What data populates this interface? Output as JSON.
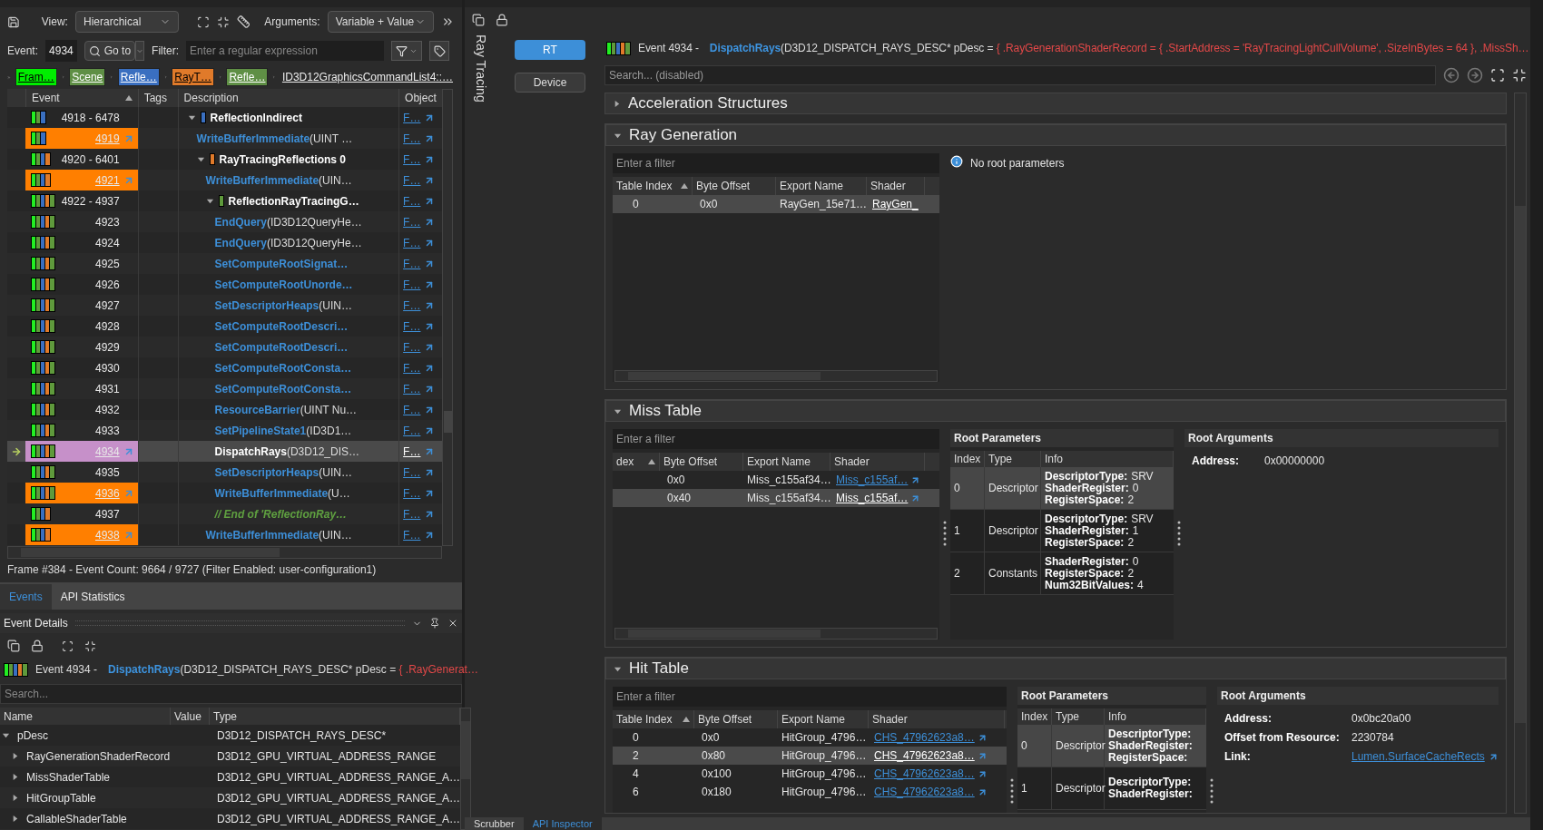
{
  "events": {
    "toolbar": {
      "view_label": "View:",
      "view_value": "Hierarchical",
      "arguments_label": "Arguments:",
      "arguments_value": "Variable + Value"
    },
    "search": {
      "event_label": "Event:",
      "event_value": "4934",
      "goto_label": "Go to",
      "filter_label": "Filter:",
      "filter_placeholder": "Enter a regular expression"
    },
    "breadcrumbs": [
      {
        "label": "Fram…",
        "color": "#00ee00"
      },
      {
        "label": "Scene",
        "color": "#5f8f45"
      },
      {
        "label": "Refle…",
        "color": "#3a6fc0"
      },
      {
        "label": "RayT…",
        "color": "#e07a2a"
      },
      {
        "label": "Refle…",
        "color": "#5f8f45"
      },
      {
        "label": "ID3D12GraphicsCommandList4::…"
      }
    ],
    "columns": [
      "Event",
      "Tags",
      "Description",
      "Object"
    ],
    "rows": [
      {
        "event": "4918 - 6478",
        "markers": [
          {
            "color": "#22ee22"
          },
          {
            "color": "#5f9a3c"
          },
          {
            "color": "#3a6fc0"
          }
        ],
        "marked": false,
        "selected": false,
        "kind": "group",
        "name": "ReflectionIndirect",
        "color": "#3a6fc0",
        "expanded": true,
        "object": "F…",
        "children": [
          {
            "event": "4919",
            "markers": [
              {
                "color": "#22ee22"
              },
              {
                "color": "#5f9a3c"
              },
              {
                "color": "#3a6fc0"
              }
            ],
            "marked": true,
            "selected": false,
            "kind": "call",
            "name": "WriteBufferImmediate",
            "args": "(UINT …",
            "object": "F…"
          },
          {
            "event": "4920 - 6401",
            "markers": [
              {
                "color": "#22ee22"
              },
              {
                "color": "#5f9a3c"
              },
              {
                "color": "#3a6fc0"
              },
              {
                "color": "#e07a2a"
              }
            ],
            "marked": false,
            "selected": false,
            "kind": "group",
            "name": "RayTracingReflections 0",
            "color": "#e07a2a",
            "expanded": true,
            "object": "F…",
            "children": [
              {
                "event": "4921",
                "markers": [
                  {
                    "color": "#22ee22"
                  },
                  {
                    "color": "#5f9a3c"
                  },
                  {
                    "color": "#3a6fc0"
                  },
                  {
                    "color": "#e07a2a"
                  }
                ],
                "marked": true,
                "selected": false,
                "kind": "call",
                "name": "WriteBufferImmediate",
                "args": "(UIN…",
                "object": "F…"
              },
              {
                "event": "4922 - 4937",
                "markers": [
                  {
                    "color": "#22ee22"
                  },
                  {
                    "color": "#5f9a3c"
                  },
                  {
                    "color": "#3a6fc0"
                  },
                  {
                    "color": "#e07a2a"
                  },
                  {
                    "color": "#5f9a3c"
                  }
                ],
                "marked": false,
                "selected": false,
                "kind": "group",
                "name": "ReflectionRayTracingG…",
                "color": "#5f9a3c",
                "expanded": true,
                "object": "F…",
                "children": [
                  {
                    "event": "4923",
                    "markers": [
                      {
                        "color": "#22ee22"
                      },
                      {
                        "color": "#5f9a3c"
                      },
                      {
                        "color": "#3a6fc0"
                      },
                      {
                        "color": "#e07a2a"
                      },
                      {
                        "color": "#5f9a3c"
                      }
                    ],
                    "marked": false,
                    "selected": false,
                    "kind": "call",
                    "name": "EndQuery",
                    "args": "(ID3D12QueryHe…",
                    "object": "F…"
                  },
                  {
                    "event": "4924",
                    "markers": [
                      {
                        "color": "#22ee22"
                      },
                      {
                        "color": "#5f9a3c"
                      },
                      {
                        "color": "#3a6fc0"
                      },
                      {
                        "color": "#e07a2a"
                      },
                      {
                        "color": "#5f9a3c"
                      }
                    ],
                    "marked": false,
                    "selected": false,
                    "kind": "call",
                    "name": "EndQuery",
                    "args": "(ID3D12QueryHe…",
                    "object": "F…"
                  },
                  {
                    "event": "4925",
                    "markers": [
                      {
                        "color": "#22ee22"
                      },
                      {
                        "color": "#5f9a3c"
                      },
                      {
                        "color": "#3a6fc0"
                      },
                      {
                        "color": "#e07a2a"
                      },
                      {
                        "color": "#5f9a3c"
                      }
                    ],
                    "marked": false,
                    "selected": false,
                    "kind": "call",
                    "name": "SetComputeRootSignat…",
                    "object": "F…"
                  },
                  {
                    "event": "4926",
                    "markers": [
                      {
                        "color": "#22ee22"
                      },
                      {
                        "color": "#5f9a3c"
                      },
                      {
                        "color": "#3a6fc0"
                      },
                      {
                        "color": "#e07a2a"
                      },
                      {
                        "color": "#5f9a3c"
                      }
                    ],
                    "marked": false,
                    "selected": false,
                    "kind": "call",
                    "name": "SetComputeRootUnorde…",
                    "object": "F…"
                  },
                  {
                    "event": "4927",
                    "markers": [
                      {
                        "color": "#22ee22"
                      },
                      {
                        "color": "#5f9a3c"
                      },
                      {
                        "color": "#3a6fc0"
                      },
                      {
                        "color": "#e07a2a"
                      },
                      {
                        "color": "#5f9a3c"
                      }
                    ],
                    "marked": false,
                    "selected": false,
                    "kind": "call",
                    "name": "SetDescriptorHeaps",
                    "args": "(UIN…",
                    "object": "F…"
                  },
                  {
                    "event": "4928",
                    "markers": [
                      {
                        "color": "#22ee22"
                      },
                      {
                        "color": "#5f9a3c"
                      },
                      {
                        "color": "#3a6fc0"
                      },
                      {
                        "color": "#e07a2a"
                      },
                      {
                        "color": "#5f9a3c"
                      }
                    ],
                    "marked": false,
                    "selected": false,
                    "kind": "call",
                    "name": "SetComputeRootDescri…",
                    "object": "F…"
                  },
                  {
                    "event": "4929",
                    "markers": [
                      {
                        "color": "#22ee22"
                      },
                      {
                        "color": "#5f9a3c"
                      },
                      {
                        "color": "#3a6fc0"
                      },
                      {
                        "color": "#e07a2a"
                      },
                      {
                        "color": "#5f9a3c"
                      }
                    ],
                    "marked": false,
                    "selected": false,
                    "kind": "call",
                    "name": "SetComputeRootDescri…",
                    "object": "F…"
                  },
                  {
                    "event": "4930",
                    "markers": [
                      {
                        "color": "#22ee22"
                      },
                      {
                        "color": "#5f9a3c"
                      },
                      {
                        "color": "#3a6fc0"
                      },
                      {
                        "color": "#e07a2a"
                      },
                      {
                        "color": "#5f9a3c"
                      }
                    ],
                    "marked": false,
                    "selected": false,
                    "kind": "call",
                    "name": "SetComputeRootConsta…",
                    "object": "F…"
                  },
                  {
                    "event": "4931",
                    "markers": [
                      {
                        "color": "#22ee22"
                      },
                      {
                        "color": "#5f9a3c"
                      },
                      {
                        "color": "#3a6fc0"
                      },
                      {
                        "color": "#e07a2a"
                      },
                      {
                        "color": "#5f9a3c"
                      }
                    ],
                    "marked": false,
                    "selected": false,
                    "kind": "call",
                    "name": "SetComputeRootConsta…",
                    "object": "F…"
                  },
                  {
                    "event": "4932",
                    "markers": [
                      {
                        "color": "#22ee22"
                      },
                      {
                        "color": "#5f9a3c"
                      },
                      {
                        "color": "#3a6fc0"
                      },
                      {
                        "color": "#e07a2a"
                      },
                      {
                        "color": "#5f9a3c"
                      }
                    ],
                    "marked": false,
                    "selected": false,
                    "kind": "call",
                    "name": "ResourceBarrier",
                    "args": "(UINT Nu…",
                    "object": "F…"
                  },
                  {
                    "event": "4933",
                    "markers": [
                      {
                        "color": "#22ee22"
                      },
                      {
                        "color": "#5f9a3c"
                      },
                      {
                        "color": "#3a6fc0"
                      },
                      {
                        "color": "#e07a2a"
                      },
                      {
                        "color": "#5f9a3c"
                      }
                    ],
                    "marked": false,
                    "selected": false,
                    "kind": "call",
                    "name": "SetPipelineState1",
                    "args": "(ID3D1…",
                    "object": "F…"
                  },
                  {
                    "event": "4934",
                    "markers": [
                      {
                        "color": "#22ee22"
                      },
                      {
                        "color": "#5f9a3c"
                      },
                      {
                        "color": "#3a6fc0"
                      },
                      {
                        "color": "#e07a2a"
                      },
                      {
                        "color": "#5f9a3c"
                      }
                    ],
                    "marked": false,
                    "selected": true,
                    "kind": "call",
                    "name": "DispatchRays",
                    "args": "(D3D12_DIS…",
                    "object": "F…"
                  },
                  {
                    "event": "4935",
                    "markers": [
                      {
                        "color": "#22ee22"
                      },
                      {
                        "color": "#5f9a3c"
                      },
                      {
                        "color": "#3a6fc0"
                      },
                      {
                        "color": "#e07a2a"
                      },
                      {
                        "color": "#5f9a3c"
                      }
                    ],
                    "marked": false,
                    "selected": false,
                    "kind": "call",
                    "name": "SetDescriptorHeaps",
                    "args": "(UIN…",
                    "object": "F…"
                  },
                  {
                    "event": "4936",
                    "markers": [
                      {
                        "color": "#22ee22"
                      },
                      {
                        "color": "#5f9a3c"
                      },
                      {
                        "color": "#3a6fc0"
                      },
                      {
                        "color": "#e07a2a"
                      },
                      {
                        "color": "#5f9a3c"
                      }
                    ],
                    "marked": true,
                    "selected": false,
                    "kind": "call",
                    "name": "WriteBufferImmediate",
                    "args": "(U…",
                    "object": "F…"
                  },
                  {
                    "event": "4937",
                    "markers": [
                      {
                        "color": "#22ee22"
                      },
                      {
                        "color": "#5f9a3c"
                      },
                      {
                        "color": "#3a6fc0"
                      },
                      {
                        "color": "#e07a2a"
                      }
                    ],
                    "marked": false,
                    "selected": false,
                    "kind": "comment",
                    "name": "// End of 'ReflectionRay…",
                    "object": "F…"
                  }
                ]
              },
              {
                "event": "4938",
                "markers": [
                  {
                    "color": "#22ee22"
                  },
                  {
                    "color": "#5f9a3c"
                  },
                  {
                    "color": "#3a6fc0"
                  },
                  {
                    "color": "#e07a2a"
                  }
                ],
                "marked": true,
                "selected": false,
                "kind": "call",
                "name": "WriteBufferImmediate",
                "args": "(UIN…",
                "object": "F…"
              }
            ]
          }
        ]
      }
    ],
    "status": "Frame #384 - Event Count: 9664 / 9727 (Filter Enabled: user-configuration1)",
    "tabs": [
      {
        "label": "Events",
        "selected": true
      },
      {
        "label": "API Statistics",
        "selected": false
      }
    ]
  },
  "event_details": {
    "title": "Event Details",
    "event_line": {
      "markers": [
        {
          "color": "#22ee22"
        },
        {
          "color": "#5f9a3c"
        },
        {
          "color": "#3a6fc0"
        },
        {
          "color": "#e07a2a"
        },
        {
          "color": "#5f9a3c"
        }
      ],
      "event": "Event 4934 -",
      "function": "DispatchRays",
      "signature": "(D3D12_DISPATCH_RAYS_DESC* pDesc = ",
      "value": "{ .RayGenerat…"
    },
    "search_placeholder": "Search...",
    "columns": [
      "Name",
      "Value",
      "Type"
    ],
    "rows": [
      {
        "name": "pDesc",
        "type": "D3D12_DISPATCH_RAYS_DESC*",
        "expanded": true,
        "children": [
          {
            "name": "RayGenerationShaderRecord",
            "type": "D3D12_GPU_VIRTUAL_ADDRESS_RANGE",
            "expanded": false
          },
          {
            "name": "MissShaderTable",
            "type": "D3D12_GPU_VIRTUAL_ADDRESS_RANGE_A…",
            "expanded": false
          },
          {
            "name": "HitGroupTable",
            "type": "D3D12_GPU_VIRTUAL_ADDRESS_RANGE_A…",
            "expanded": false
          },
          {
            "name": "CallableShaderTable",
            "type": "D3D12_GPU_VIRTUAL_ADDRESS_RANGE_A…",
            "expanded": false
          }
        ]
      }
    ]
  },
  "inspector": {
    "vertical_tab": "Ray Tracing",
    "modes": [
      {
        "label": "RT",
        "selected": true
      },
      {
        "label": "Device",
        "selected": false
      }
    ],
    "event_line": {
      "markers": [
        {
          "color": "#22ee22"
        },
        {
          "color": "#5f9a3c"
        },
        {
          "color": "#3a6fc0"
        },
        {
          "color": "#e07a2a"
        },
        {
          "color": "#5f9a3c"
        }
      ],
      "event": "Event 4934 -",
      "function": "DispatchRays",
      "signature": "(D3D12_DISPATCH_RAYS_DESC* pDesc = ",
      "value": "{ .RayGenerationShaderRecord = { .StartAddress = 'RayTracingLightCullVolume', .SizeInBytes = 64 }, .MissSh…"
    },
    "search_placeholder": "Search... (disabled)",
    "sections": [
      {
        "title": "Acceleration Structures",
        "expanded": false
      },
      {
        "title": "Ray Generation",
        "expanded": true,
        "filter_placeholder": "Enter a filter",
        "columns": [
          "Table Index",
          "Byte Offset",
          "Export Name",
          "Shader"
        ],
        "rows": [
          {
            "index": "0",
            "byte_offset": "0x0",
            "export_name": "RayGen_15e71…",
            "shader": "RayGen_",
            "selected": true,
            "link_icon": false
          }
        ],
        "root_info": "No root parameters"
      },
      {
        "title": "Miss Table",
        "expanded": true,
        "filter_placeholder": "Enter a filter",
        "columns": [
          "dex",
          "Byte Offset",
          "Export Name",
          "Shader"
        ],
        "rows": [
          {
            "byte_offset": "0x0",
            "export_name": "Miss_c155af34…",
            "shader": "Miss_c155af…",
            "selected": false,
            "link_icon": true
          },
          {
            "byte_offset": "0x40",
            "export_name": "Miss_c155af34…",
            "shader": "Miss_c155af…",
            "selected": true,
            "link_icon": true
          }
        ],
        "root_parameters": {
          "title": "Root Parameters",
          "columns": [
            "Index",
            "Type",
            "Info"
          ],
          "rows": [
            {
              "index": "0",
              "type": "Descriptor",
              "selected": true,
              "info": [
                {
                  "key": "DescriptorType:",
                  "value": "SRV"
                },
                {
                  "key": "ShaderRegister:",
                  "value": "0"
                },
                {
                  "key": "RegisterSpace:",
                  "value": "2"
                }
              ]
            },
            {
              "index": "1",
              "type": "Descriptor",
              "selected": false,
              "info": [
                {
                  "key": "DescriptorType:",
                  "value": "SRV"
                },
                {
                  "key": "ShaderRegister:",
                  "value": "1"
                },
                {
                  "key": "RegisterSpace:",
                  "value": "2"
                }
              ]
            },
            {
              "index": "2",
              "type": "Constants",
              "selected": false,
              "info": [
                {
                  "key": "ShaderRegister:",
                  "value": "0"
                },
                {
                  "key": "RegisterSpace:",
                  "value": "2"
                },
                {
                  "key": "Num32BitValues:",
                  "value": "4"
                }
              ]
            }
          ]
        },
        "root_arguments": {
          "title": "Root Arguments",
          "items": [
            {
              "key": "Address:",
              "value": "0x00000000",
              "kind": "text"
            }
          ]
        }
      },
      {
        "title": "Hit Table",
        "expanded": true,
        "filter_placeholder": "Enter a filter",
        "columns": [
          "Table Index",
          "Byte Offset",
          "Export Name",
          "Shader"
        ],
        "rows": [
          {
            "index": "0",
            "byte_offset": "0x0",
            "export_name": "HitGroup_4796…",
            "shader": "CHS_47962623a8…",
            "selected": false,
            "link_icon": true
          },
          {
            "index": "2",
            "byte_offset": "0x80",
            "export_name": "HitGroup_4796…",
            "shader": "CHS_47962623a8…",
            "selected": true,
            "link_icon": true
          },
          {
            "index": "4",
            "byte_offset": "0x100",
            "export_name": "HitGroup_4796…",
            "shader": "CHS_47962623a8…",
            "selected": false,
            "link_icon": true
          },
          {
            "index": "6",
            "byte_offset": "0x180",
            "export_name": "HitGroup_4796…",
            "shader": "CHS_47962623a8…",
            "selected": false,
            "link_icon": true
          }
        ],
        "root_parameters": {
          "title": "Root Parameters",
          "columns": [
            "Index",
            "Type",
            "Info"
          ],
          "rows": [
            {
              "index": "0",
              "type": "Descriptor",
              "selected": true,
              "info": [
                {
                  "key": "DescriptorType:"
                },
                {
                  "key": "ShaderRegister:"
                },
                {
                  "key": "RegisterSpace:"
                }
              ]
            },
            {
              "index": "1",
              "type": "Descriptor",
              "selected": false,
              "info": [
                {
                  "key": "DescriptorType:"
                },
                {
                  "key": "ShaderRegister:"
                }
              ]
            }
          ]
        },
        "root_arguments": {
          "title": "Root Arguments",
          "items": [
            {
              "key": "Address:",
              "value": "0x0bc20a00",
              "kind": "text"
            },
            {
              "key": "Offset from Resource:",
              "value": "2230784",
              "kind": "text"
            },
            {
              "key": "Link:",
              "value": "Lumen.SurfaceCacheRects",
              "kind": "link"
            }
          ]
        }
      }
    ]
  },
  "bottom_tabs": [
    {
      "label": "Scrubber",
      "selected": false
    },
    {
      "label": "API Inspector",
      "selected": true
    }
  ]
}
